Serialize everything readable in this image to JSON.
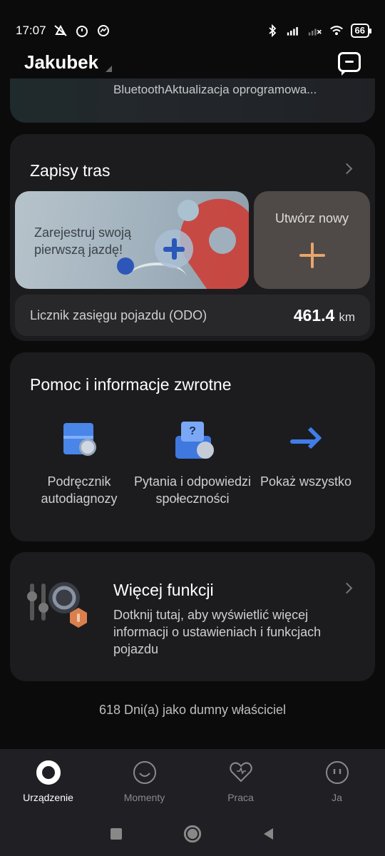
{
  "status_bar": {
    "time": "17:07",
    "battery": "66",
    "icons": [
      "mute-icon",
      "alarm-icon",
      "messenger-icon",
      "bluetooth-icon",
      "signal-icon",
      "signal-off-icon",
      "wifi-icon"
    ]
  },
  "header": {
    "account_name": "Jakubek"
  },
  "top_card": {
    "text": "BluetoothAktualizacja oprogramowa..."
  },
  "routes": {
    "title": "Zapisy tras",
    "first_ride_text": "Zarejestruj swoją pierwszą jazdę!",
    "create_new_label": "Utwórz nowy",
    "odo_label": "Licznik zasięgu pojazdu (ODO)",
    "odo_value": "461.4",
    "odo_unit": "km"
  },
  "help": {
    "title": "Pomoc i informacje zwrotne",
    "items": [
      {
        "label": "Podręcznik autodiagnozy"
      },
      {
        "label": "Pytania i odpowiedzi społeczności"
      },
      {
        "label": "Pokaż wszystko"
      }
    ]
  },
  "more": {
    "title": "Więcej funkcji",
    "description": "Dotknij tutaj, aby wyświetlić więcej informacji o ustawieniach i funkcjach pojazdu"
  },
  "owner_text": "618 Dni(a) jako dumny właściciel",
  "bottom_nav": {
    "items": [
      {
        "label": "Urządzenie",
        "active": true
      },
      {
        "label": "Momenty"
      },
      {
        "label": "Praca"
      },
      {
        "label": "Ja"
      }
    ]
  },
  "colors": {
    "background": "#0b0b0c",
    "card": "#1c1c1f",
    "accent_blue": "#3f7de8",
    "accent_orange": "#e8a56a",
    "pin_red": "#c9433d"
  }
}
